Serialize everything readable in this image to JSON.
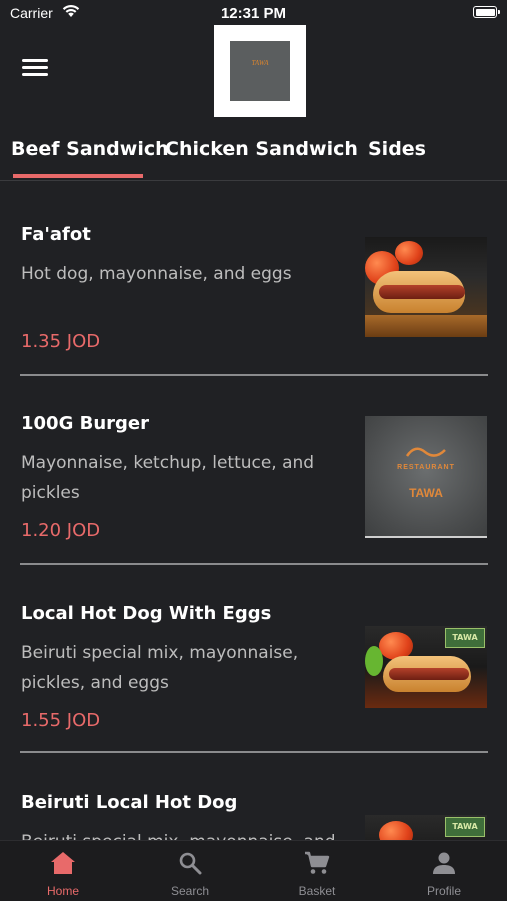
{
  "status_bar": {
    "carrier": "Carrier",
    "time": "12:31 PM"
  },
  "header": {
    "logo_text": "TAWA",
    "menu_icon": "hamburger-menu-icon"
  },
  "tabs": [
    {
      "label": "Beef Sandwich",
      "active": true
    },
    {
      "label": "Chicken Sandwich",
      "active": false
    },
    {
      "label": "Sides",
      "active": false
    }
  ],
  "items": [
    {
      "name": "Fa'afot",
      "description": "Hot dog, mayonnaise, and eggs",
      "price": "1.35 JOD"
    },
    {
      "name": "100G Burger",
      "description": "Mayonnaise, ketchup, lettuce, and pickles",
      "price": "1.20 JOD"
    },
    {
      "name": "Local Hot Dog With Eggs",
      "description": "Beiruti special mix, mayonnaise, pickles, and eggs",
      "price": "1.55 JOD"
    },
    {
      "name": "Beiruti Local Hot Dog",
      "description": "Beiruti special mix, mayonnaise, and",
      "price": ""
    }
  ],
  "item_images": {
    "restaurant_word": "RESTAURANT",
    "brand": "TAWA"
  },
  "bottom_nav": [
    {
      "label": "Home",
      "icon": "home-icon",
      "active": true
    },
    {
      "label": "Search",
      "icon": "search-icon",
      "active": false
    },
    {
      "label": "Basket",
      "icon": "cart-icon",
      "active": false
    },
    {
      "label": "Profile",
      "icon": "profile-icon",
      "active": false
    }
  ],
  "colors": {
    "background": "#202124",
    "accent": "#e86a6a",
    "text_primary": "#ffffff",
    "text_secondary": "#bdbdbd"
  }
}
